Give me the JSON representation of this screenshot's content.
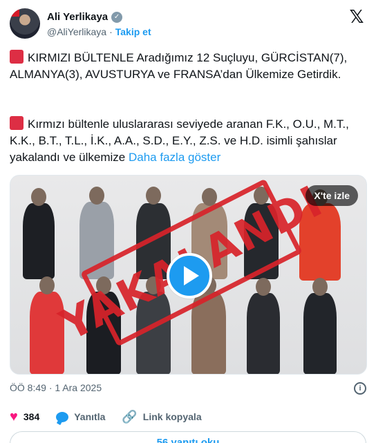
{
  "author": {
    "name": "Ali Yerlikaya",
    "handle": "@AliYerlikaya",
    "separator": "·",
    "follow_label": "Takip et",
    "verified_mark": "✓"
  },
  "brand_icon": "x-logo-icon",
  "post": {
    "paragraph1": "KIRMIZI BÜLTENLE Aradığımız 12 Suçluyu, GÜRCİSTAN(7), ALMANYA(3), AVUSTURYA ve FRANSA’dan Ülkemize Getirdik.",
    "paragraph2": "Kırmızı bültenle uluslararası seviyede aranan F.K., O.U., M.T., K.K., B.T., T.L., İ.K., A.A., S.D., E.Y., Z.S. ve H.D. isimli şahıslar yakalandı ve ülkemize",
    "show_more": "Daha fazla göster"
  },
  "media": {
    "stamp_text": "YAKALANDI",
    "watch_label": "X'te izle",
    "play_icon": "play-icon"
  },
  "meta": {
    "time": "ÖÖ 8:49",
    "separator": "·",
    "date": "1 Ara 2025",
    "info_icon": "i"
  },
  "actions": {
    "likes": "384",
    "reply_label": "Yanıtla",
    "copy_link_label": "Link kopyala"
  },
  "replies_button": "56 yanıtı oku",
  "colors": {
    "accent": "#1d9bf0",
    "like": "#f91880",
    "stamp": "#d8232a",
    "square_emoji": "#dd2e44"
  }
}
